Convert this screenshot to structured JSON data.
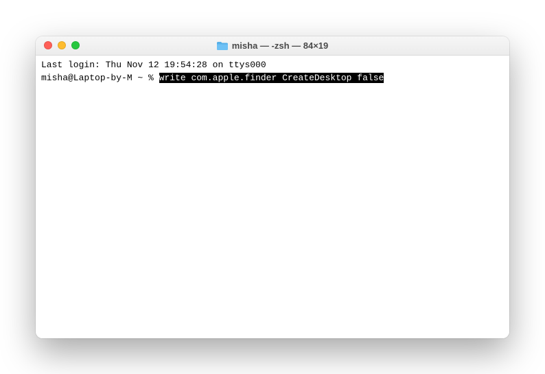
{
  "window": {
    "title": "misha — -zsh — 84×19"
  },
  "terminal": {
    "last_login": "Last login: Thu Nov 12 19:54:28 on ttys000",
    "prompt": "misha@Laptop-by-M ~ % ",
    "command_selected": "write com.apple.finder CreateDesktop false"
  }
}
